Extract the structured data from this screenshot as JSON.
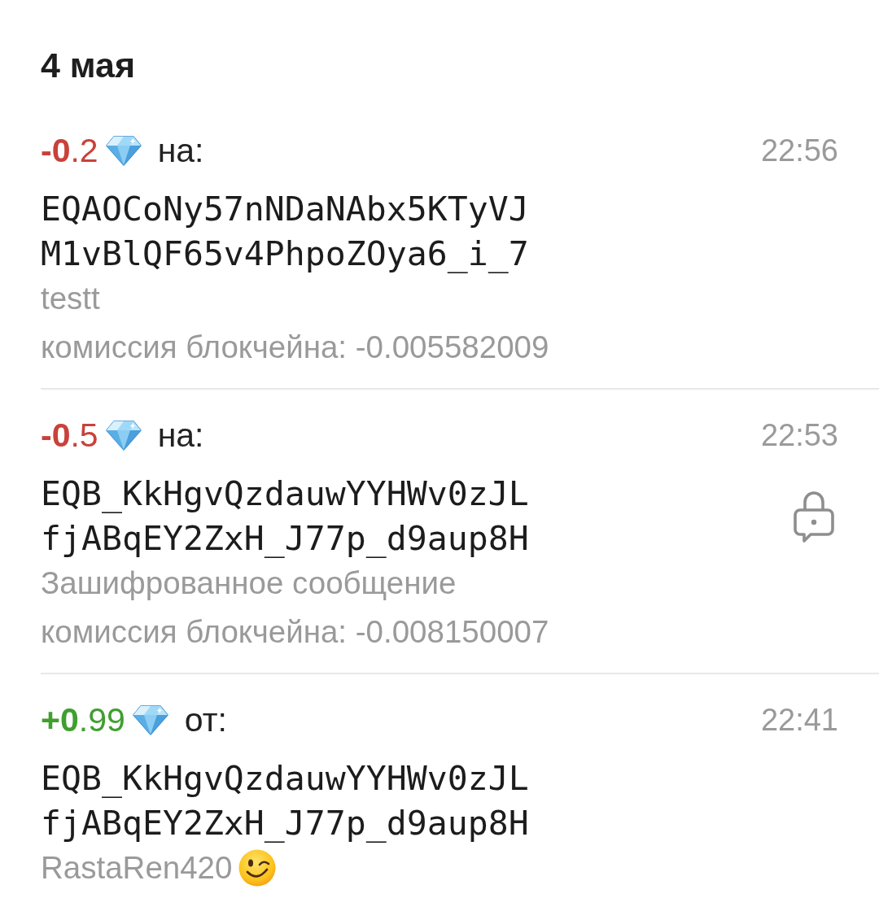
{
  "date_header": "4 мая",
  "transactions": [
    {
      "kind": "outgoing",
      "amount": "**-0**.2",
      "direction_label": "на:",
      "time": "22:56",
      "address": "EQAOCoNy57nNDaNAbx5KTyVJM1vBlQF65v4PhpoZOya6_i_7",
      "comment": "testt",
      "winking_emoji": false,
      "encrypted": false,
      "fee": "комиссия блокчейна: -0.005582009"
    },
    {
      "kind": "outgoing",
      "amount": "**-0**.5",
      "direction_label": "на:",
      "time": "22:53",
      "address": "EQB_KkHgvQzdauwYYHWv0zJLfjABqEY2ZxH_J77p_d9aup8H",
      "comment": "Зашифрованное сообщение",
      "winking_emoji": false,
      "encrypted": true,
      "fee": "комиссия блокчейна: -0.008150007"
    },
    {
      "kind": "incoming",
      "amount": "**+0**.99",
      "direction_label": "от:",
      "time": "22:41",
      "address": "EQB_KkHgvQzdauwYYHWv0zJLfjABqEY2ZxH_J77p_d9aup8H",
      "comment": "RastaRen420",
      "winking_emoji": true,
      "encrypted": false
    }
  ]
}
